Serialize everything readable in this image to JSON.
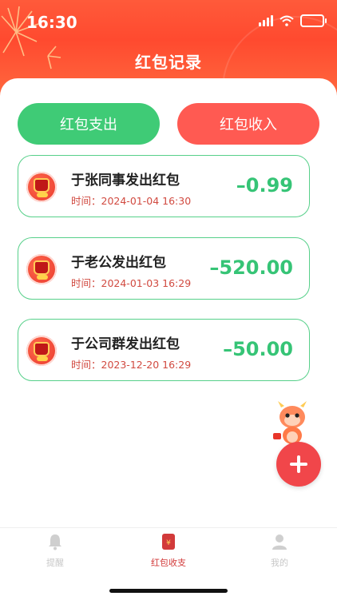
{
  "status_bar": {
    "time": "16:30"
  },
  "header": {
    "title": "红包记录"
  },
  "segment": {
    "expense_label": "红包支出",
    "income_label": "红包收入"
  },
  "records": [
    {
      "title": "于张同事发出红包",
      "time": "时间：2024-01-04 16:30",
      "amount": "–0.99"
    },
    {
      "title": "于老公发出红包",
      "time": "时间：2024-01-03 16:29",
      "amount": "–520.00"
    },
    {
      "title": "于公司群发出红包",
      "time": "时间：2023-12-20 16:29",
      "amount": "–50.00"
    }
  ],
  "tabbar": {
    "remind": "提醒",
    "redpacket": "红包收支",
    "mine": "我的"
  },
  "colors": {
    "header": "#ff4a2f",
    "expense": "#3fcb76",
    "income": "#ff5a52",
    "amount": "#36c476",
    "fab": "#f1464a"
  },
  "icons": {
    "fab": "plus-icon",
    "tab_remind": "bell-icon",
    "tab_red": "red-envelope-icon",
    "tab_mine": "person-icon"
  }
}
